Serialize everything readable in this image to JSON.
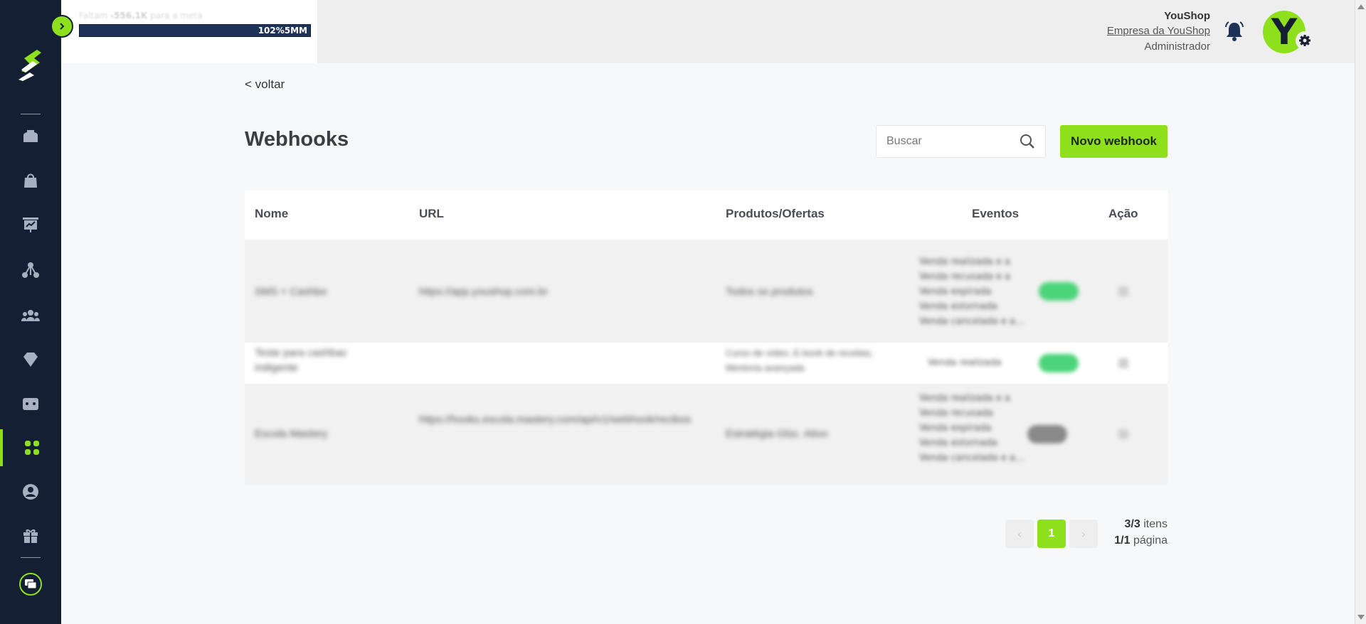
{
  "sidebar": {
    "items": [
      {
        "name": "home-icon"
      },
      {
        "name": "shopping-bag-icon"
      },
      {
        "name": "presentation-chart-icon"
      },
      {
        "name": "network-icon"
      },
      {
        "name": "users-group-icon"
      },
      {
        "name": "diamond-icon"
      },
      {
        "name": "wallet-icon"
      },
      {
        "name": "apps-grid-icon",
        "active": true
      },
      {
        "name": "user-circle-icon"
      },
      {
        "name": "gift-icon"
      },
      {
        "name": "chat-icon"
      }
    ],
    "accent": "#8fe01c",
    "background": "#141f33"
  },
  "goal": {
    "prefix": "Faltam",
    "amount": "-556.1K",
    "suffix": "para a meta",
    "bar_label": "102%5MM",
    "progress": 1.0
  },
  "user": {
    "name": "YouShop",
    "company": "Empresa da YouShop",
    "role": "Administrador",
    "avatar_letter": "Y"
  },
  "page": {
    "back": "< voltar",
    "title": "Webhooks",
    "search_placeholder": "Buscar",
    "new_button": "Novo webhook"
  },
  "table": {
    "headers": {
      "name": "Nome",
      "url": "URL",
      "products": "Produtos/Ofertas",
      "events": "Eventos",
      "action": "Ação"
    },
    "rows": [
      {
        "name": "SMS + Cashbo",
        "url": "https://app.youshop.com.br",
        "products": "Todos os produtos",
        "events": [
          "Venda realizada e a",
          "Venda recusada e a",
          "Venda expirada",
          "Venda estornada",
          "Venda cancelada e a..."
        ],
        "status": "on"
      },
      {
        "name": "Teste para cashbac indigente",
        "url": "",
        "products": "Curso de vídeo, E-book de receitas, Mentoria avançada",
        "events": [
          "Venda realizada"
        ],
        "status": "on"
      },
      {
        "name": "Escola Mastery",
        "url": "https://hooks.escola.mastery.com/api/v1/webhook/recibos",
        "products": "Estratégia Glúc. Ativo",
        "events": [
          "Venda realizada e a",
          "Venda recusada",
          "Venda expirada",
          "Venda estornada",
          "Venda cancelada e a..."
        ],
        "status": "off"
      }
    ]
  },
  "pagination": {
    "current": "1",
    "prev": "‹",
    "next": "›",
    "items_count": "3/3",
    "items_label": "itens",
    "page_count": "1/1",
    "page_label": "página"
  }
}
